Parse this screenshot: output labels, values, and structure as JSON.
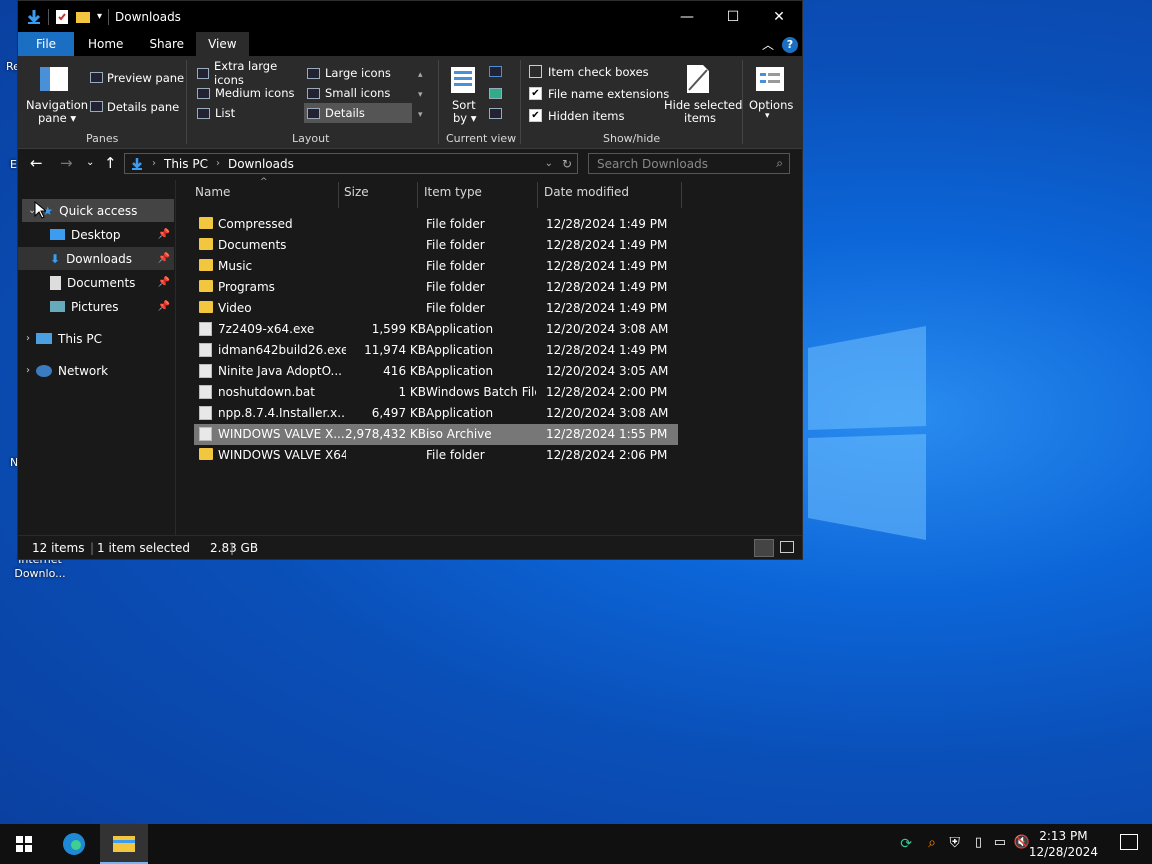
{
  "window": {
    "title": "Downloads"
  },
  "ribbon_tabs": [
    "File",
    "Home",
    "Share",
    "View"
  ],
  "ribbon": {
    "panes": {
      "navigation_pane_1": "Navigation",
      "navigation_pane_2": "pane ▾",
      "preview_pane": "Preview pane",
      "details_pane": "Details pane",
      "label": "Panes"
    },
    "layout": {
      "items": [
        "Extra large icons",
        "Large icons",
        "Medium icons",
        "Small icons",
        "List",
        "Details"
      ],
      "selected": "Details",
      "label": "Layout"
    },
    "current_view": {
      "sort_by_1": "Sort",
      "sort_by_2": "by ▾",
      "label": "Current view"
    },
    "show_hide": {
      "item_check_boxes": "Item check boxes",
      "file_name_extensions": "File name extensions",
      "hidden_items": "Hidden items",
      "hide_selected_1": "Hide selected",
      "hide_selected_2": "items",
      "label": "Show/hide"
    },
    "options": {
      "label": "Options",
      "arrow": "▾"
    }
  },
  "address": {
    "path": [
      "This PC",
      "Downloads"
    ],
    "search_placeholder": "Search Downloads"
  },
  "nav_pane": {
    "quick_access": "Quick access",
    "items": [
      "Desktop",
      "Downloads",
      "Documents",
      "Pictures"
    ],
    "this_pc": "This PC",
    "network": "Network"
  },
  "columns": [
    "Name",
    "Size",
    "Item type",
    "Date modified"
  ],
  "files": [
    {
      "name": "Compressed",
      "size": "",
      "type": "File folder",
      "date": "12/28/2024 1:49 PM",
      "folder": true
    },
    {
      "name": "Documents",
      "size": "",
      "type": "File folder",
      "date": "12/28/2024 1:49 PM",
      "folder": true
    },
    {
      "name": "Music",
      "size": "",
      "type": "File folder",
      "date": "12/28/2024 1:49 PM",
      "folder": true
    },
    {
      "name": "Programs",
      "size": "",
      "type": "File folder",
      "date": "12/28/2024 1:49 PM",
      "folder": true
    },
    {
      "name": "Video",
      "size": "",
      "type": "File folder",
      "date": "12/28/2024 1:49 PM",
      "folder": true
    },
    {
      "name": "7z2409-x64.exe",
      "size": "1,599 KB",
      "type": "Application",
      "date": "12/20/2024 3:08 AM",
      "folder": false
    },
    {
      "name": "idman642build26.exe",
      "size": "11,974 KB",
      "type": "Application",
      "date": "12/28/2024 1:49 PM",
      "folder": false
    },
    {
      "name": "Ninite Java AdoptO...",
      "size": "416 KB",
      "type": "Application",
      "date": "12/20/2024 3:05 AM",
      "folder": false
    },
    {
      "name": "noshutdown.bat",
      "size": "1 KB",
      "type": "Windows Batch File",
      "date": "12/28/2024 2:00 PM",
      "folder": false
    },
    {
      "name": "npp.8.7.4.Installer.x...",
      "size": "6,497 KB",
      "type": "Application",
      "date": "12/20/2024 3:08 AM",
      "folder": false
    },
    {
      "name": "WINDOWS VALVE X...",
      "size": "2,978,432 KB",
      "type": "iso Archive",
      "date": "12/28/2024 1:55 PM",
      "folder": false,
      "selected": true
    },
    {
      "name": "WINDOWS VALVE X64",
      "size": "",
      "type": "File folder",
      "date": "12/28/2024 2:06 PM",
      "folder": true
    }
  ],
  "status": {
    "count": "12 items",
    "selected": "1 item selected",
    "size": "2.83 GB"
  },
  "desktop": {
    "icon_label": "Internet Downlo...",
    "frag_1": "Re",
    "frag_2": "E",
    "frag_3": "N"
  },
  "taskbar": {
    "time": "2:13 PM",
    "date": "12/28/2024"
  }
}
